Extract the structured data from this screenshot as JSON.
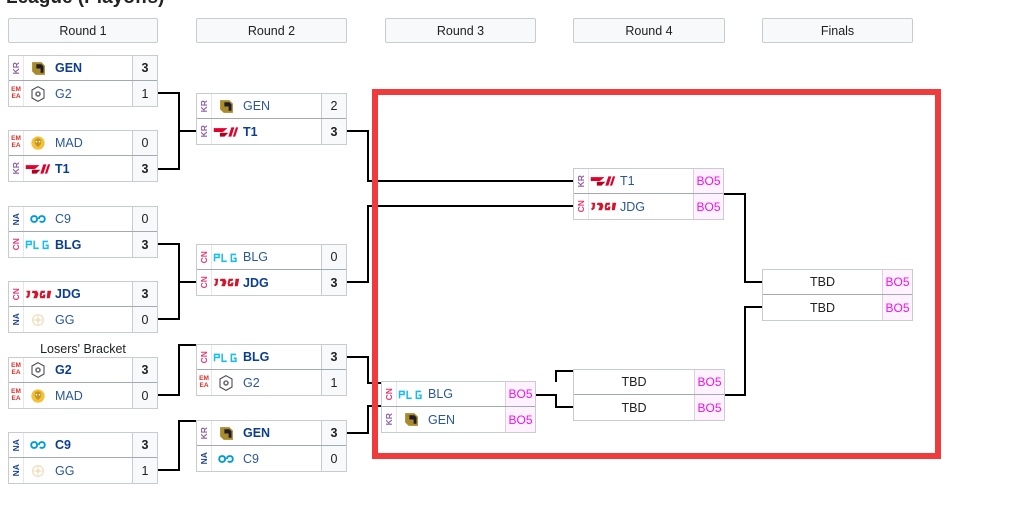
{
  "page": {
    "title_cutoff": "League (Playoffs)"
  },
  "rounds": [
    {
      "label": "Round 1"
    },
    {
      "label": "Round 2"
    },
    {
      "label": "Round 3"
    },
    {
      "label": "Round 4"
    },
    {
      "label": "Finals"
    }
  ],
  "labels": {
    "losers_bracket": "Losers' Bracket"
  },
  "colors": {
    "highlight_box": "#ef3b3b",
    "region_kr": "#8f5ea8",
    "region_cn": "#e8336d",
    "region_na": "#17408b",
    "region_emea": "#e02a26",
    "bo_text": "#ee11ee",
    "bo_bg": "#fdf2fd",
    "team_link": "#2b5797"
  },
  "matches": {
    "r1m1": {
      "top": {
        "region": "KR",
        "logo": "gen-logo",
        "team": "GEN",
        "score": "3",
        "winner": true
      },
      "bottom": {
        "region": "EMEA",
        "logo": "g2-logo",
        "team": "G2",
        "score": "1",
        "winner": false
      }
    },
    "r1m2": {
      "top": {
        "region": "EMEA",
        "logo": "mad-logo",
        "team": "MAD",
        "score": "0",
        "winner": false
      },
      "bottom": {
        "region": "KR",
        "logo": "t1-logo",
        "team": "T1",
        "score": "3",
        "winner": true
      }
    },
    "r1m3": {
      "top": {
        "region": "NA",
        "logo": "c9-logo",
        "team": "C9",
        "score": "0",
        "winner": false
      },
      "bottom": {
        "region": "CN",
        "logo": "blg-logo",
        "team": "BLG",
        "score": "3",
        "winner": true
      }
    },
    "r1m4": {
      "top": {
        "region": "CN",
        "logo": "jdg-logo",
        "team": "JDG",
        "score": "3",
        "winner": true
      },
      "bottom": {
        "region": "NA",
        "logo": "gg-logo",
        "team": "GG",
        "score": "0",
        "winner": false
      }
    },
    "r1m5": {
      "top": {
        "region": "EMEA",
        "logo": "g2-logo",
        "team": "G2",
        "score": "3",
        "winner": true
      },
      "bottom": {
        "region": "EMEA",
        "logo": "mad-logo",
        "team": "MAD",
        "score": "0",
        "winner": false
      }
    },
    "r1m6": {
      "top": {
        "region": "NA",
        "logo": "c9-logo",
        "team": "C9",
        "score": "3",
        "winner": true
      },
      "bottom": {
        "region": "NA",
        "logo": "gg-logo",
        "team": "GG",
        "score": "1",
        "winner": false
      }
    },
    "r2m1": {
      "top": {
        "region": "KR",
        "logo": "gen-logo",
        "team": "GEN",
        "score": "2",
        "winner": false
      },
      "bottom": {
        "region": "KR",
        "logo": "t1-logo",
        "team": "T1",
        "score": "3",
        "winner": true
      }
    },
    "r2m2": {
      "top": {
        "region": "CN",
        "logo": "blg-logo",
        "team": "BLG",
        "score": "0",
        "winner": false
      },
      "bottom": {
        "region": "CN",
        "logo": "jdg-logo",
        "team": "JDG",
        "score": "3",
        "winner": true
      }
    },
    "r2m3": {
      "top": {
        "region": "CN",
        "logo": "blg-logo",
        "team": "BLG",
        "score": "3",
        "winner": true
      },
      "bottom": {
        "region": "EMEA",
        "logo": "g2-logo",
        "team": "G2",
        "score": "1",
        "winner": false
      }
    },
    "r2m4": {
      "top": {
        "region": "KR",
        "logo": "gen-logo",
        "team": "GEN",
        "score": "3",
        "winner": true
      },
      "bottom": {
        "region": "NA",
        "logo": "c9-logo",
        "team": "C9",
        "score": "0",
        "winner": false
      }
    },
    "r3m1": {
      "top": {
        "region": "KR",
        "logo": "t1-logo",
        "team": "T1",
        "score": "BO5",
        "winner": false
      },
      "bottom": {
        "region": "CN",
        "logo": "jdg-logo",
        "team": "JDG",
        "score": "BO5",
        "winner": false
      }
    },
    "r3m2": {
      "top": {
        "region": "CN",
        "logo": "blg-logo",
        "team": "BLG",
        "score": "BO5",
        "winner": false
      },
      "bottom": {
        "region": "KR",
        "logo": "gen-logo",
        "team": "GEN",
        "score": "BO5",
        "winner": false
      }
    },
    "r4m1": {
      "top": {
        "region": "",
        "logo": "",
        "team": "TBD",
        "score": "BO5",
        "winner": false
      },
      "bottom": {
        "region": "",
        "logo": "",
        "team": "TBD",
        "score": "BO5",
        "winner": false
      }
    },
    "finals": {
      "top": {
        "region": "",
        "logo": "",
        "team": "TBD",
        "score": "BO5",
        "winner": false
      },
      "bottom": {
        "region": "",
        "logo": "",
        "team": "TBD",
        "score": "BO5",
        "winner": false
      }
    }
  }
}
